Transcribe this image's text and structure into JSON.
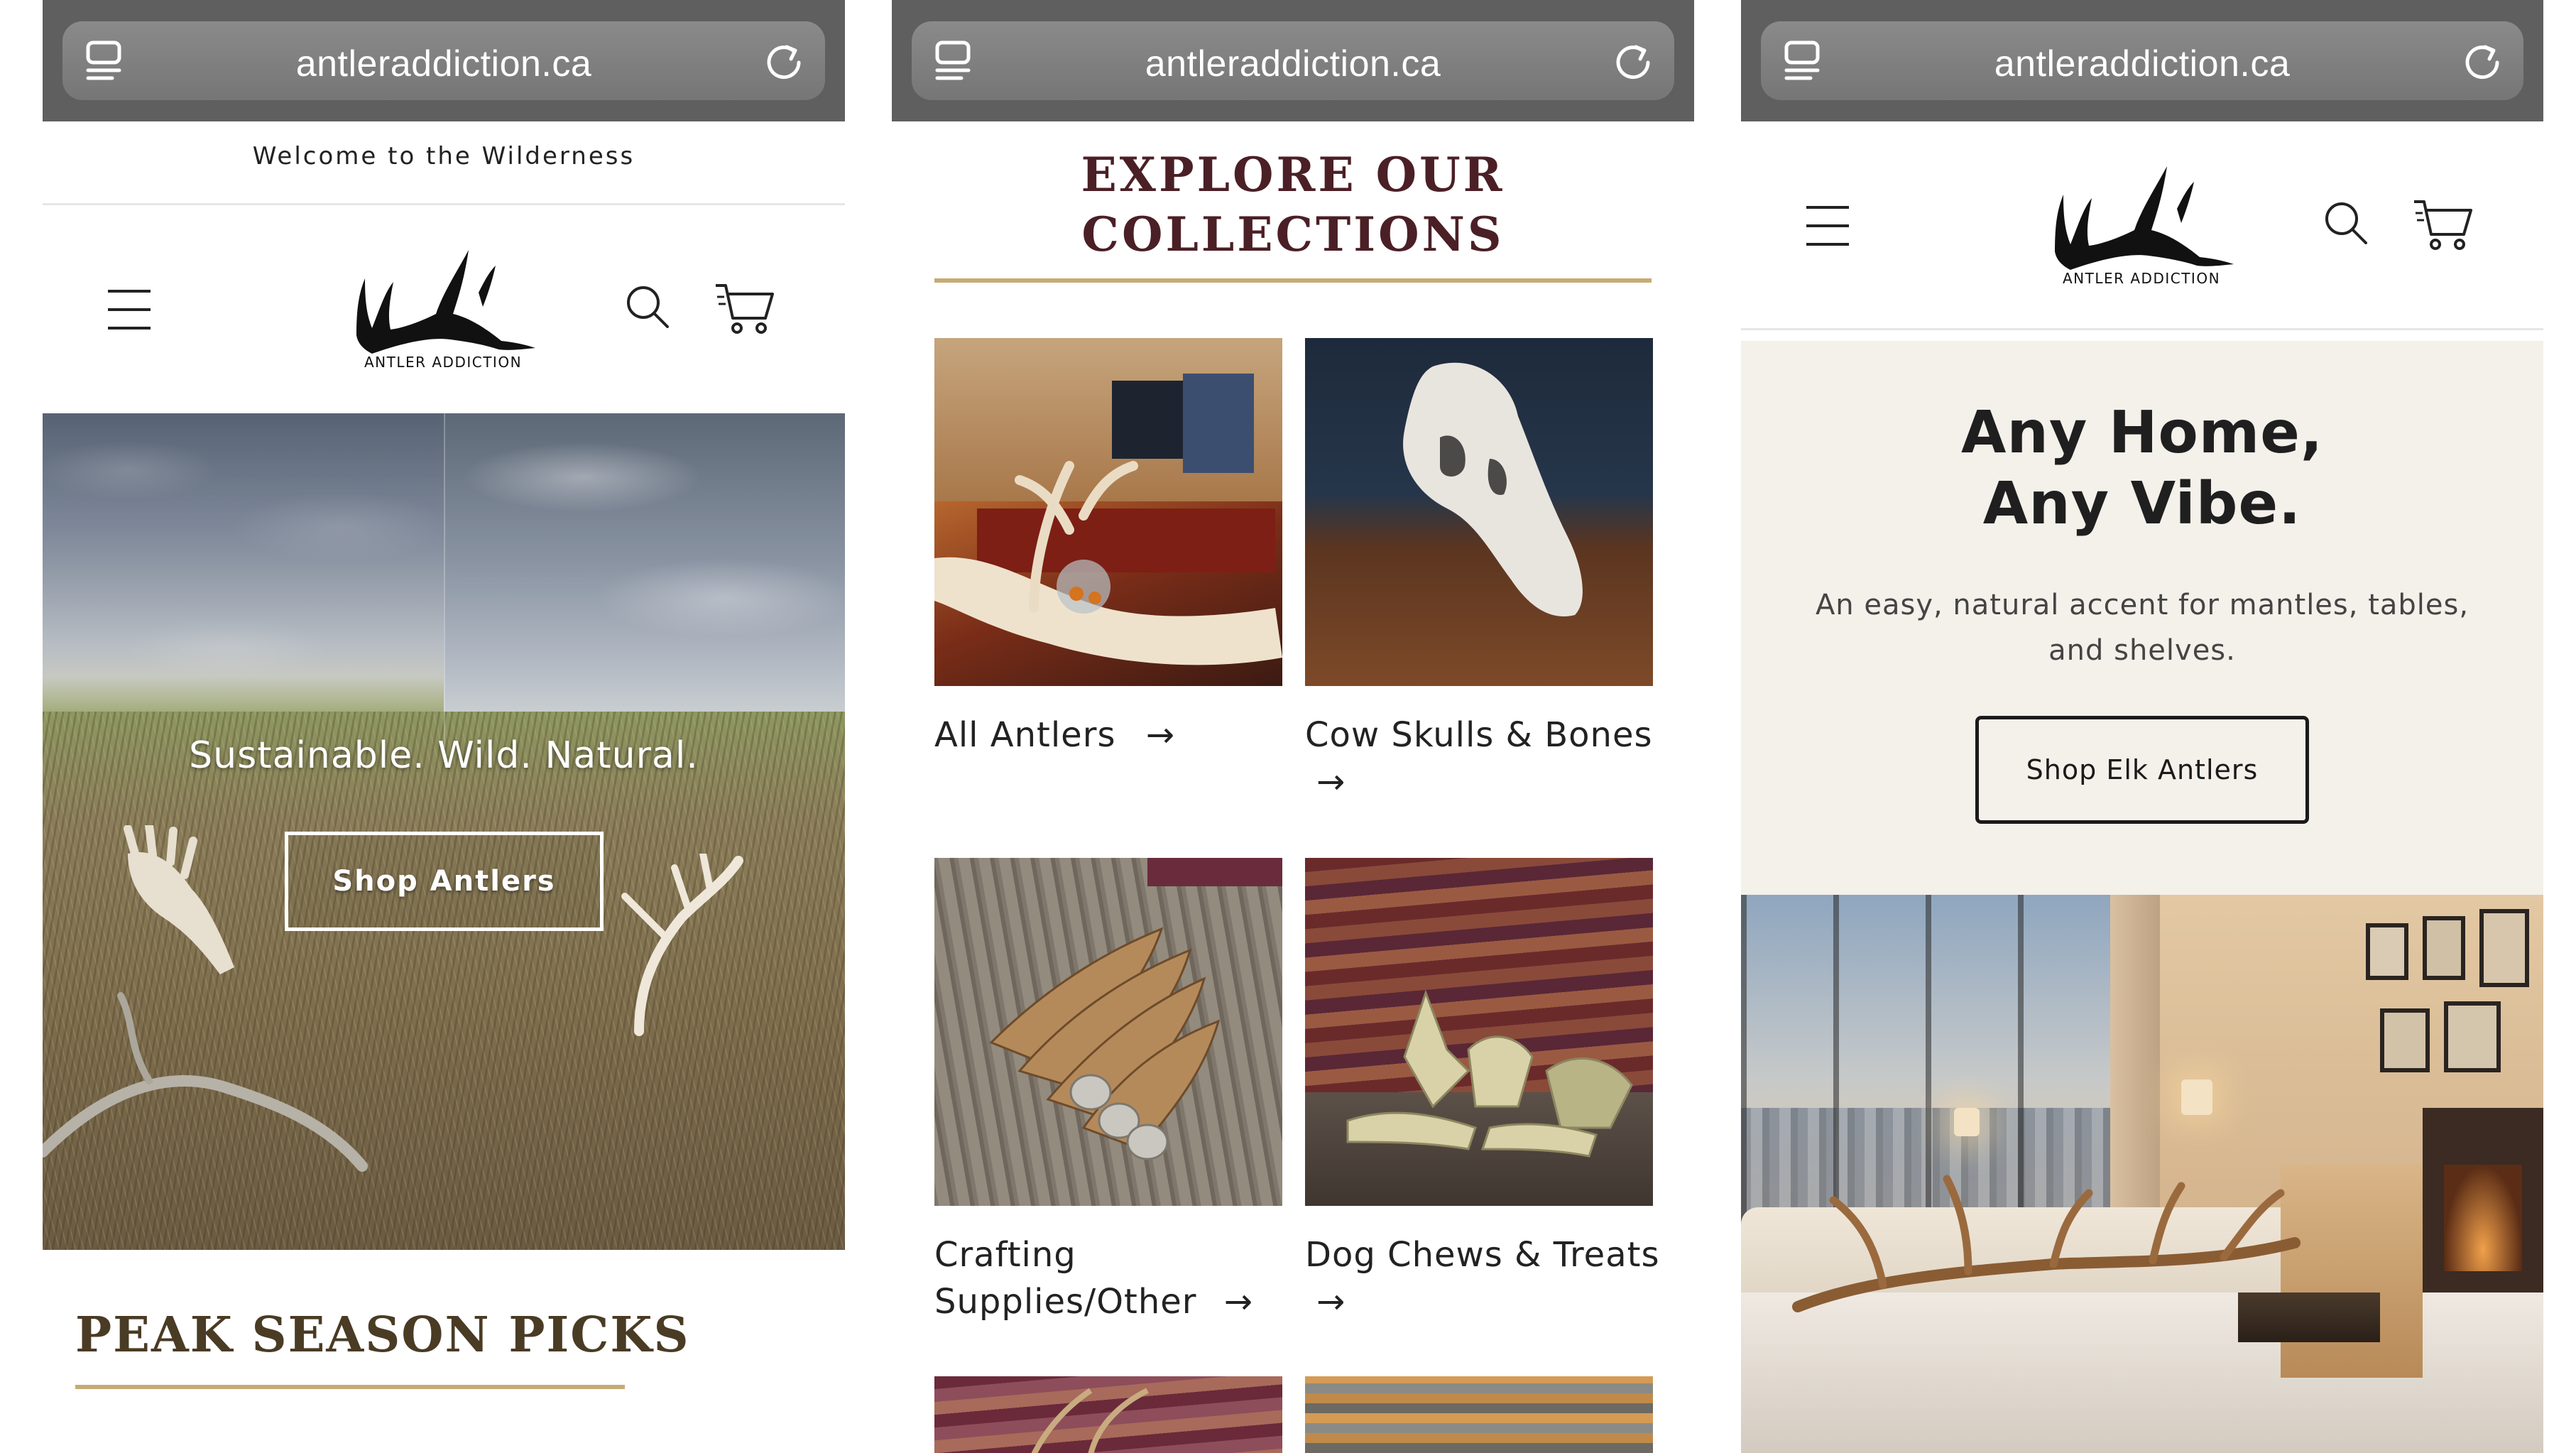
{
  "browser": {
    "url": "antleraddiction.ca"
  },
  "brand": {
    "name": "ANTLER ADDICTION",
    "accent_gold": "#c6ac74",
    "heading_brown": "#4a3b24",
    "heading_maroon": "#4b1f26"
  },
  "home": {
    "announcement": "Welcome to the Wilderness",
    "hero_text": "Sustainable. Wild. Natural.",
    "hero_button": "Shop Antlers",
    "section_title": "PEAK SEASON PICKS"
  },
  "collections": {
    "title_line1": "EXPLORE OUR",
    "title_line2": "COLLECTIONS",
    "arrow": "→",
    "items": [
      {
        "label": "All Antlers"
      },
      {
        "label_line1": "Cow Skulls & Bones"
      },
      {
        "label_line1": "Crafting",
        "label_line2": "Supplies/Other"
      },
      {
        "label_line1": "Dog Chews & Treats"
      }
    ]
  },
  "feature": {
    "title_line1": "Any Home,",
    "title_line2": "Any Vibe.",
    "subtitle": "An easy, natural accent for mantles, tables, and shelves.",
    "button": "Shop Elk Antlers"
  },
  "icons": [
    "tabs-icon",
    "reload-icon",
    "menu-icon",
    "search-icon",
    "cart-icon",
    "arrow-right-icon"
  ]
}
